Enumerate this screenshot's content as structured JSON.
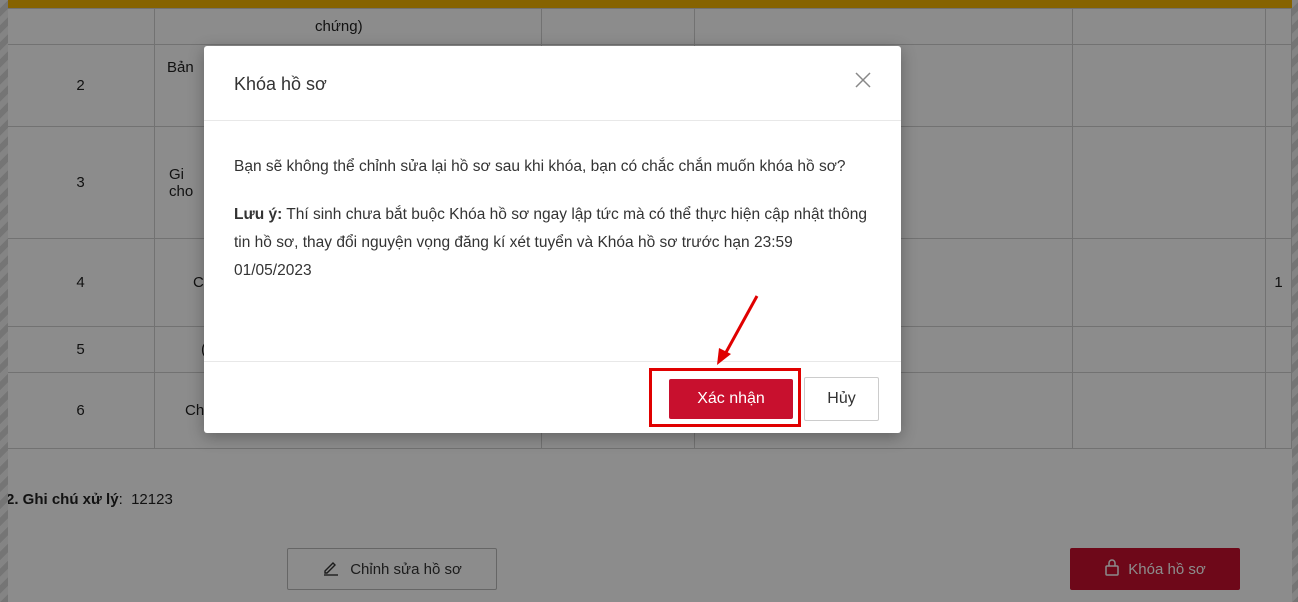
{
  "table": {
    "rows": [
      {
        "stt": "",
        "name": "chứng)"
      },
      {
        "stt": "2",
        "name": "Bản"
      },
      {
        "stt": "3",
        "name": "Gi\ncho"
      },
      {
        "stt": "4",
        "name": "C",
        "count": "1"
      },
      {
        "stt": "5",
        "name": "("
      },
      {
        "stt": "6",
        "name": "Ch"
      }
    ]
  },
  "note": {
    "label": "2. Ghi chú xử lý",
    "sep": ":",
    "value": "12123"
  },
  "actions": {
    "edit_label": "Chỉnh sửa hồ sơ",
    "lock_label": "Khóa hồ sơ"
  },
  "modal": {
    "title": "Khóa hồ sơ",
    "message": "Bạn sẽ không thể chỉnh sửa lại hồ sơ sau khi khóa, bạn có chắc chắn muốn khóa hồ sơ?",
    "note_label": "Lưu ý:",
    "note_text": " Thí sinh chưa bắt buộc Khóa hồ sơ ngay lập tức mà có thể thực hiện cập nhật thông tin hồ sơ, thay đổi nguyện vọng đăng kí xét tuyển và Khóa hồ sơ trước hạn 23:59 01/05/2023",
    "confirm_label": "Xác nhận",
    "cancel_label": "Hủy"
  },
  "colors": {
    "accent": "#c8102e",
    "frame": "#f5b400",
    "highlight": "#e00000"
  },
  "icons": {
    "close": "close-icon",
    "edit": "pencil-icon",
    "lock": "lock-icon"
  }
}
